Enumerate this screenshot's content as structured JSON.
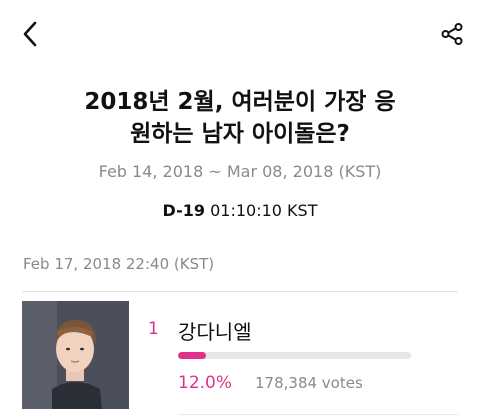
{
  "poll": {
    "title_line1": "2018년 2월, 여러분이 가장 응",
    "title_line2": "원하는 남자 아이돌은?",
    "date_range": "Feb 14, 2018 ~ Mar 08, 2018 (KST)",
    "countdown_dday": "D-19",
    "countdown_time": "01:10:10 KST",
    "updated_at": "Feb 17, 2018 22:40 (KST)"
  },
  "icons": {
    "back": "chevron-left-icon",
    "share": "share-icon"
  },
  "colors": {
    "accent": "#e0318a",
    "muted_text": "#8a8a8a",
    "progress_track": "#e6e6e6"
  },
  "ranking": [
    {
      "rank": "1",
      "name": "강다니엘",
      "percent_label": "12.0%",
      "percent_value": 0.12,
      "votes": "178,384 votes"
    }
  ]
}
